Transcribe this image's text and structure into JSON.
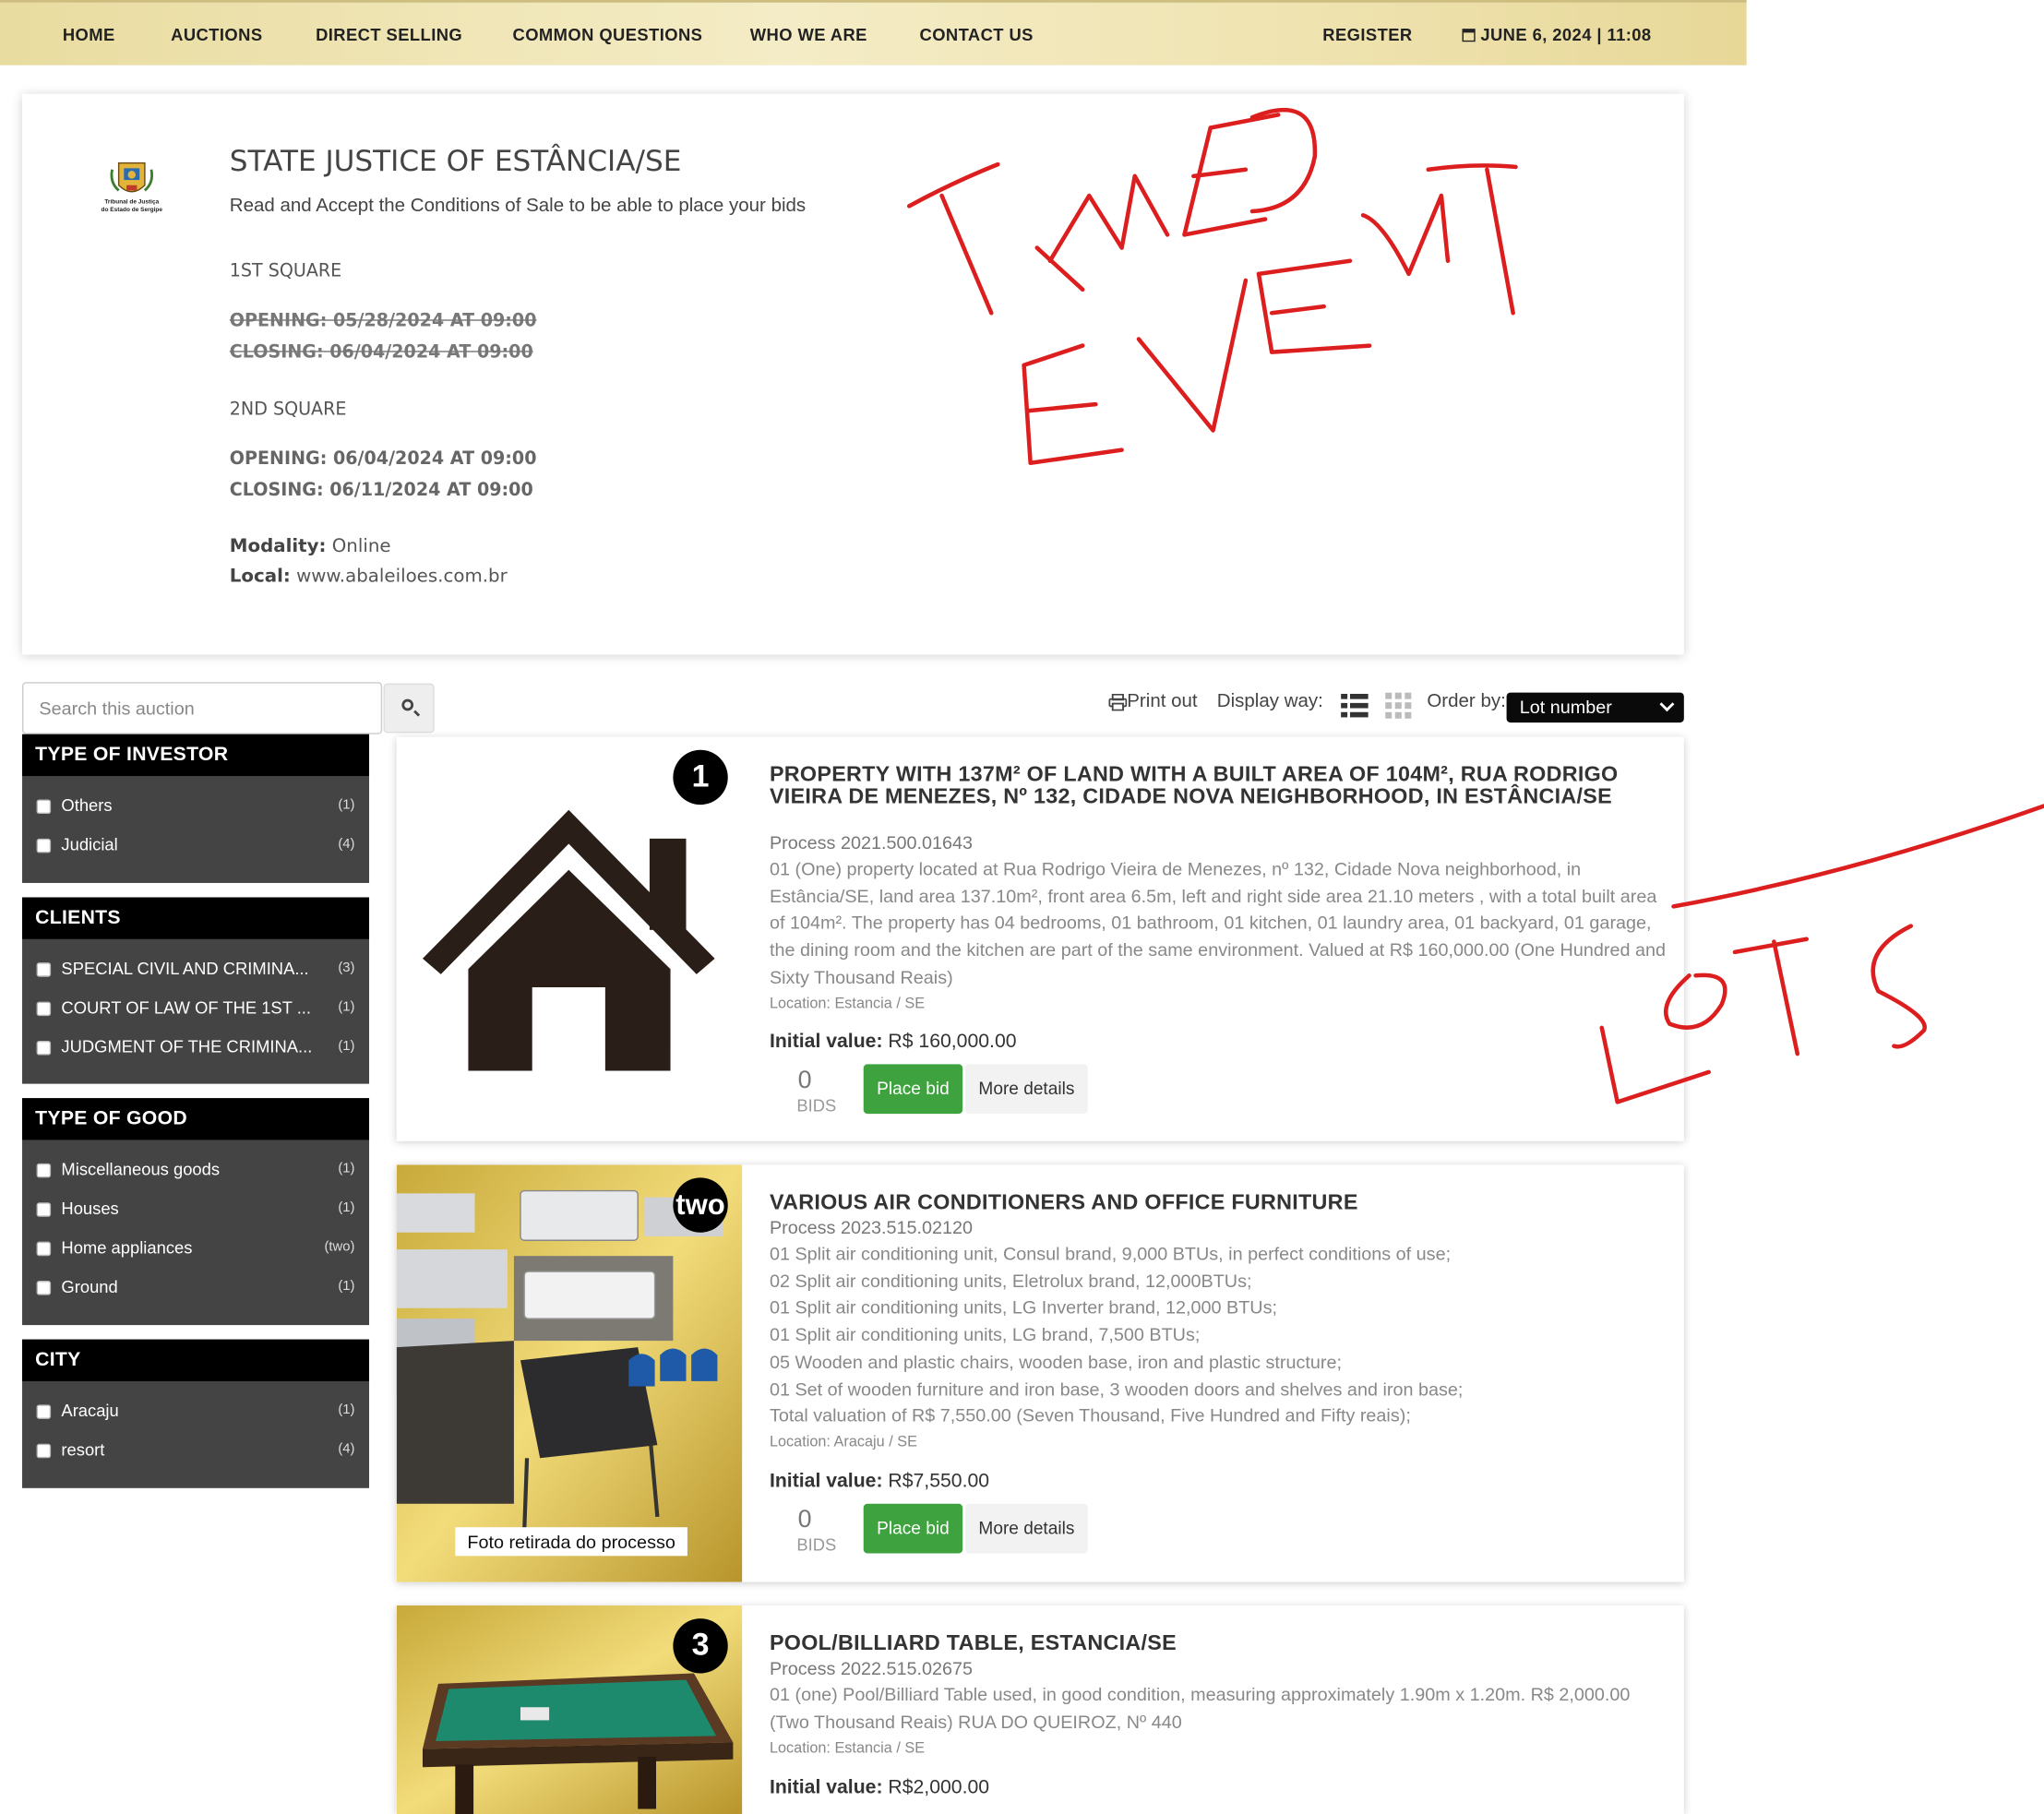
{
  "nav": {
    "home": "HOME",
    "auctions": "AUCTIONS",
    "direct_selling": "DIRECT SELLING",
    "common_questions": "COMMON QUESTIONS",
    "who_we_are": "WHO WE ARE",
    "contact_us": "CONTACT US",
    "register": "REGISTER",
    "datetime": "JUNE 6, 2024 | 11:08"
  },
  "event": {
    "title": "STATE JUSTICE OF ESTÂNCIA/SE",
    "subtitle": "Read and Accept the Conditions of Sale to be able to place your bids",
    "seal_text": "Tribunal de Justiça do Estado de Sergipe",
    "square1": {
      "label": "1ST SQUARE",
      "opening": "OPENING: 05/28/2024 AT 09:00",
      "closing": "CLOSING: 06/04/2024 AT 09:00"
    },
    "square2": {
      "label": "2ND SQUARE",
      "opening": "OPENING: 06/04/2024 AT 09:00",
      "closing": "CLOSING: 06/11/2024 AT 09:00"
    },
    "modality_label": "Modality:",
    "modality": "Online",
    "local_label": "Local:",
    "local": "www.abaleiloes.com.br"
  },
  "search": {
    "placeholder": "Search this auction"
  },
  "toolbar": {
    "print": "Print out",
    "display_way": "Display way:",
    "order_by": "Order by:",
    "order_value": "Lot number"
  },
  "filters": {
    "investor": {
      "title": "TYPE OF INVESTOR",
      "items": [
        {
          "label": "Others",
          "count": "(1)"
        },
        {
          "label": "Judicial",
          "count": "(4)"
        }
      ]
    },
    "clients": {
      "title": "CLIENTS",
      "items": [
        {
          "label": "SPECIAL CIVIL AND CRIMINA...",
          "count": "(3)"
        },
        {
          "label": "COURT OF LAW OF THE 1ST ...",
          "count": "(1)"
        },
        {
          "label": "JUDGMENT OF THE CRIMINA...",
          "count": "(1)"
        }
      ]
    },
    "good": {
      "title": "TYPE OF GOOD",
      "items": [
        {
          "label": "Miscellaneous goods",
          "count": "(1)"
        },
        {
          "label": "Houses",
          "count": "(1)"
        },
        {
          "label": "Home appliances",
          "count": "(two)"
        },
        {
          "label": "Ground",
          "count": "(1)"
        }
      ]
    },
    "city": {
      "title": "CITY",
      "items": [
        {
          "label": "Aracaju",
          "count": "(1)"
        },
        {
          "label": "resort",
          "count": "(4)"
        }
      ]
    }
  },
  "lots": [
    {
      "badge": "1",
      "title": "PROPERTY WITH 137M² OF LAND WITH A BUILT AREA OF 104M², RUA RODRIGO VIEIRA DE MENEZES, Nº 132, CIDADE NOVA NEIGHBORHOOD, IN ESTÂNCIA/SE",
      "process": "Process 2021.500.01643",
      "description": "01 (One) property located at Rua Rodrigo Vieira de Menezes, nº 132, Cidade Nova neighborhood, in Estância/SE, land area 137.10m², front area 6.5m, left and right side area 21.10 meters , with a total built area of 104m². The property has 04 bedrooms, 01 bathroom, 01 kitchen, 01 laundry area, 01 backyard, 01 garage, the dining room and the kitchen are part of the same environment. Valued at R$ 160,000.00 (One Hundred and Sixty Thousand Reais)",
      "location": "Location: Estancia / SE",
      "initial_label": "Initial value:",
      "initial_value": "R$ 160,000.00",
      "bids": "0",
      "bids_label": "BIDS",
      "bid_button": "Place bid",
      "details_button": "More details"
    },
    {
      "badge": "two",
      "title": "VARIOUS AIR CONDITIONERS AND OFFICE FURNITURE",
      "process": "Process 2023.515.02120",
      "description_lines": [
        "01 Split air conditioning unit, Consul brand, 9,000 BTUs, in perfect conditions of use;",
        "02 Split air conditioning units, Eletrolux brand, 12,000BTUs;",
        "01 Split air conditioning units, LG Inverter brand, 12,000 BTUs;",
        "01 Split air conditioning units, LG brand, 7,500 BTUs;",
        "05 Wooden and plastic chairs, wooden base, iron and plastic structure;",
        "01 Set of wooden furniture and iron base, 3 wooden doors and shelves and iron base;",
        "Total valuation of R$ 7,550.00 (Seven Thousand, Five Hundred and Fifty reais);"
      ],
      "photo_caption": "Foto retirada do processo",
      "location": "Location: Aracaju / SE",
      "initial_label": "Initial value:",
      "initial_value": "R$7,550.00",
      "bids": "0",
      "bids_label": "BIDS",
      "bid_button": "Place bid",
      "details_button": "More details"
    },
    {
      "badge": "3",
      "title": "POOL/BILLIARD TABLE, ESTANCIA/SE",
      "process": "Process 2022.515.02675",
      "description": "01 (one) Pool/Billiard Table used, in good condition, measuring approximately 1.90m x 1.20m. R$ 2,000.00 (Two Thousand Reais) RUA DO QUEIROZ, Nº 440",
      "location": "Location: Estancia / SE",
      "initial_label": "Initial value:",
      "initial_value": "R$2,000.00"
    }
  ],
  "annotations": {
    "event_note": "TIMED EVENT",
    "lots_note": "LOTS",
    "color": "#dd1e1e"
  },
  "colors": {
    "nav_gold": "#efe3b0",
    "filter_head": "#000000",
    "filter_body": "#444444",
    "bid_green": "#3ea33e"
  }
}
